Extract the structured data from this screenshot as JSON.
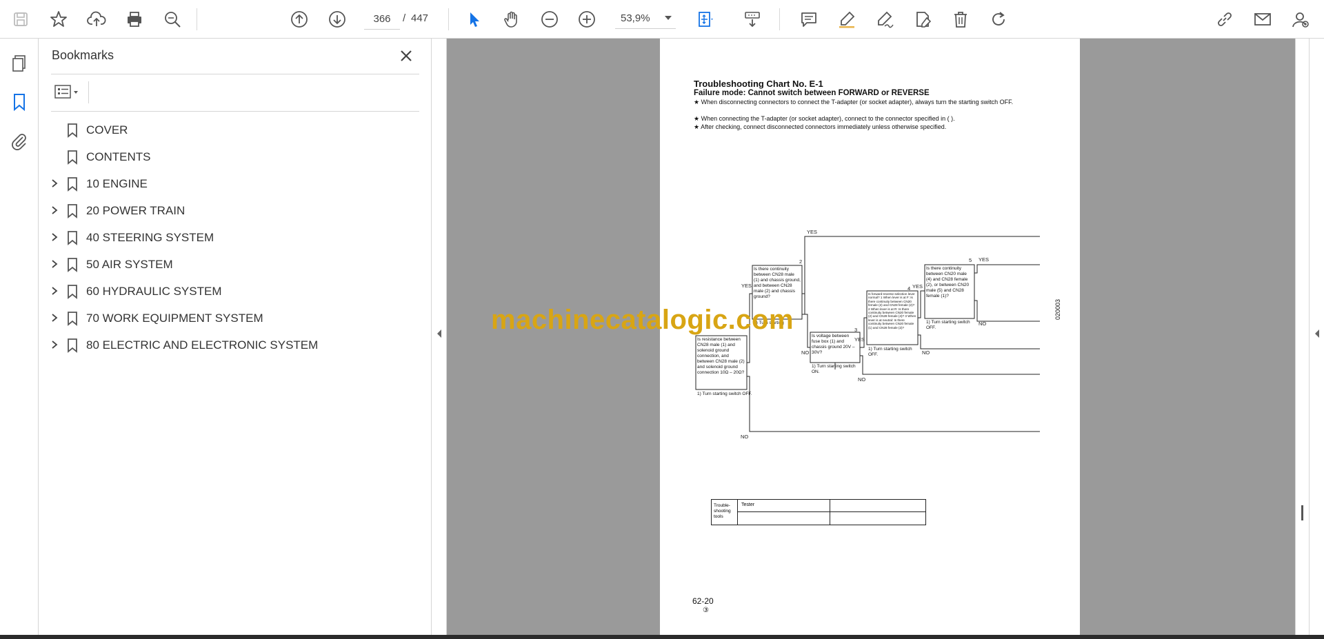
{
  "toolbar": {
    "current_page": "366",
    "page_separator": "/",
    "total_pages": "447",
    "zoom": "53,9%"
  },
  "bookmarks_panel": {
    "title": "Bookmarks",
    "items": [
      {
        "label": "COVER",
        "expandable": false
      },
      {
        "label": "CONTENTS",
        "expandable": false
      },
      {
        "label": "10 ENGINE",
        "expandable": true
      },
      {
        "label": "20 POWER TRAIN",
        "expandable": true
      },
      {
        "label": "40 STEERING SYSTEM",
        "expandable": true
      },
      {
        "label": "50 AIR SYSTEM",
        "expandable": true
      },
      {
        "label": "60 HYDRAULIC SYSTEM",
        "expandable": true
      },
      {
        "label": "70 WORK EQUIPMENT SYSTEM",
        "expandable": true
      },
      {
        "label": "80 ELECTRIC AND ELECTRONIC SYSTEM",
        "expandable": true
      }
    ]
  },
  "document": {
    "title": "Troubleshooting Chart No. E-1",
    "subtitle": "Failure mode:  Cannot switch between FORWARD or REVERSE",
    "notes": [
      "★  When disconnecting connectors to connect the T-adapter (or socket adapter), always turn the starting switch OFF.",
      "★  When connecting the T-adapter (or socket adapter), connect to the connector specified in (     ).",
      "★  After checking, connect disconnected connectors immediately unless otherwise specified."
    ],
    "flowchart": {
      "yes": "YES",
      "no": "NO",
      "step1": "Is resistance between CN28 male (1) and solenoid ground connection, and between CN28 male (2) and solenoid ground connection 10Ω – 20Ω?",
      "step1_note": "1)   Turn starting switch OFF.",
      "step2": "Is there continuity between CN28 male (1) and chassis ground, and between CN28 male (2) and chassis ground?",
      "step2_note": "1)   Turn starting",
      "step3": "Is voltage between fuse box (1) and chassis ground 20V – 30V?",
      "step3_note": "1)   Turn starting switch ON.",
      "step4": "Is forward-reverse selection lever normal? 1 When lever is at F: Is there continuity between CN20 female (2) and CN28 female (2)? 2 When lever is at R: Is there continuity between CN20 female (2) and CN28 female (4)? 3 When lever is at neutral: Is there continuity between CN20 female (1) and CN28 female (2)?",
      "step4_note": "1)   Turn starting switch OFF.",
      "step5": "Is there continuity between CN20 male (4) and CN28 female (2), or between CN20 male (5) and CN28 female (1)?",
      "step5_note": "1)   Turn starting switch OFF.",
      "nums": [
        "2",
        "3",
        "4",
        "5"
      ]
    },
    "tools_table": {
      "header": "Trouble-shooting tools",
      "tool": "Tester"
    },
    "page_number": "62-20",
    "page_circle": "③",
    "vertical_code": "020003"
  },
  "watermark": "machinecatalogic.com",
  "colors": {
    "accent_blue": "#1473e6",
    "viewer_gray": "#9a9a9a",
    "watermark": "#d8a514"
  }
}
